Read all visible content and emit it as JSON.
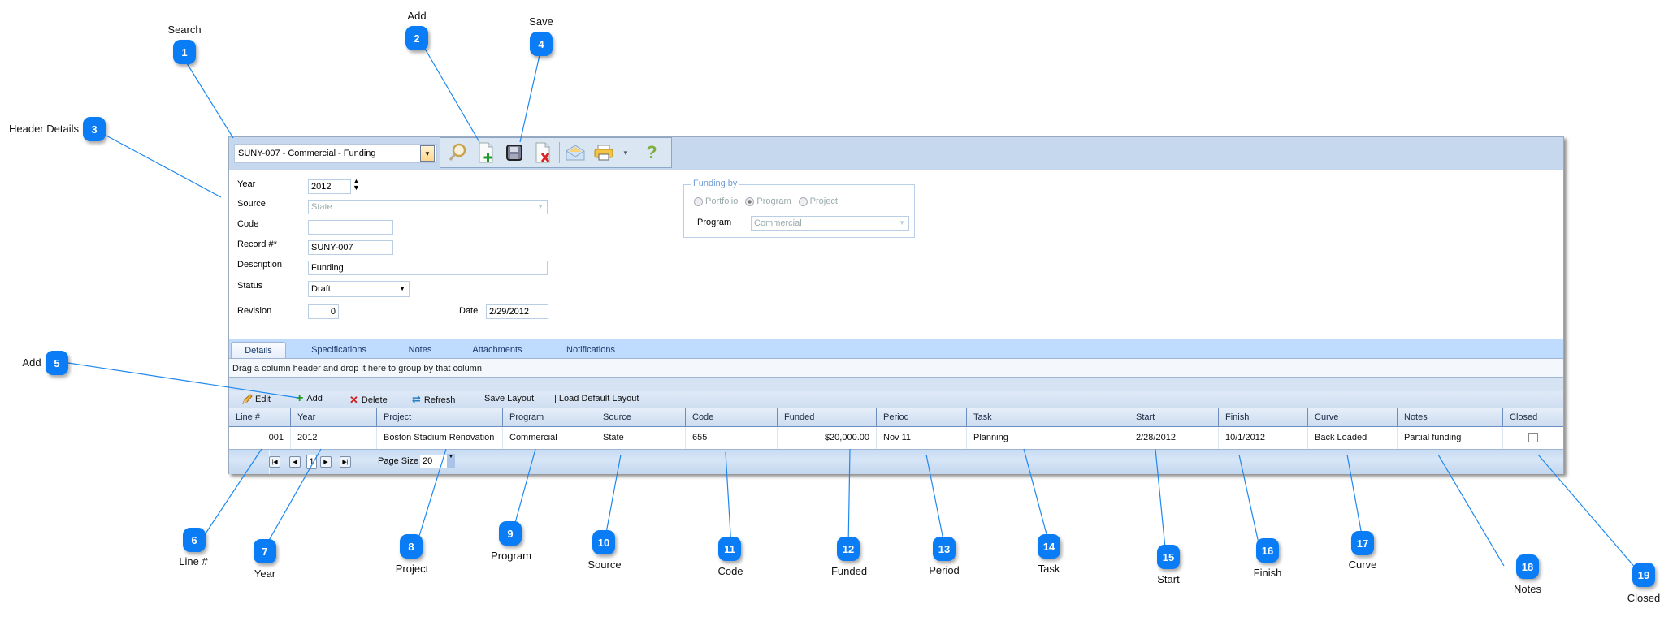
{
  "callouts": [
    {
      "n": "1",
      "label": "Search"
    },
    {
      "n": "2",
      "label": "Add"
    },
    {
      "n": "3",
      "label": "Header Details"
    },
    {
      "n": "4",
      "label": "Save"
    },
    {
      "n": "5",
      "label": "Add"
    },
    {
      "n": "6",
      "label": "Line #"
    },
    {
      "n": "7",
      "label": "Year"
    },
    {
      "n": "8",
      "label": "Project"
    },
    {
      "n": "9",
      "label": "Program"
    },
    {
      "n": "10",
      "label": "Source"
    },
    {
      "n": "11",
      "label": "Code"
    },
    {
      "n": "12",
      "label": "Funded"
    },
    {
      "n": "13",
      "label": "Period"
    },
    {
      "n": "14",
      "label": "Task"
    },
    {
      "n": "15",
      "label": "Start"
    },
    {
      "n": "16",
      "label": "Finish"
    },
    {
      "n": "17",
      "label": "Curve"
    },
    {
      "n": "18",
      "label": "Notes"
    },
    {
      "n": "19",
      "label": "Closed"
    }
  ],
  "header": {
    "search_value": "SUNY-007 - Commercial  - Funding",
    "toolbar_icons": [
      "search-icon",
      "add-document-icon",
      "save-icon",
      "delete-document-icon",
      "email-icon",
      "print-icon",
      "dropdown-arrow-icon",
      "help-icon"
    ]
  },
  "form": {
    "year_label": "Year",
    "year_value": "2012",
    "source_label": "Source",
    "source_value": "State",
    "code_label": "Code",
    "code_value": "",
    "record_label": "Record #*",
    "record_value": "SUNY-007",
    "description_label": "Description",
    "description_value": "Funding",
    "status_label": "Status",
    "status_value": "Draft",
    "revision_label": "Revision",
    "revision_value": "0",
    "date_label": "Date",
    "date_value": "2/29/2012"
  },
  "funding_by": {
    "legend": "Funding by",
    "options": [
      "Portfolio",
      "Program",
      "Project"
    ],
    "selected": "Program",
    "program_label": "Program",
    "program_value": "Commercial"
  },
  "tabs": [
    "Details",
    "Specifications",
    "Notes",
    "Attachments",
    "Notifications"
  ],
  "active_tab": "Details",
  "grid": {
    "group_hint": "Drag a column header and drop it here to group by that column",
    "toolbar": {
      "edit": "Edit",
      "add": "Add",
      "delete": "Delete",
      "refresh": "Refresh",
      "save_layout": "Save Layout",
      "load_default": "| Load Default Layout"
    },
    "columns": [
      "Line #",
      "Year",
      "Project",
      "Program",
      "Source",
      "Code",
      "Funded",
      "Period",
      "Task",
      "Start",
      "Finish",
      "Curve",
      "Notes",
      "Closed"
    ],
    "rows": [
      {
        "line": "001",
        "year": "2012",
        "project": "Boston Stadium Renovation",
        "program": "Commercial",
        "source": "State",
        "code": "655",
        "funded": "$20,000.00",
        "period": "Nov 11",
        "task": "Planning",
        "start": "2/28/2012",
        "finish": "10/1/2012",
        "curve": "Back Loaded",
        "notes": "Partial funding",
        "closed": false
      }
    ],
    "pager": {
      "current_page": "1",
      "page_size_label": "Page Size",
      "page_size": "20"
    }
  },
  "colors": {
    "accent": "#0a7cf5",
    "topbar": "#c6d8ee",
    "tabstrip": "#bfdbfd"
  }
}
